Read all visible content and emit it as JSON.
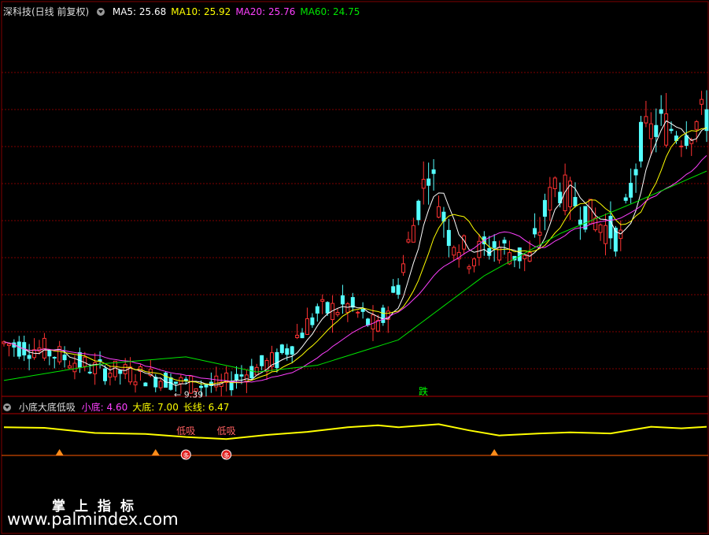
{
  "header": {
    "title": "深科技(日线 前复权)",
    "ma": [
      {
        "label": "MA5: 25.68",
        "color": "#ffffff"
      },
      {
        "label": "MA10: 25.92",
        "color": "#ffff00"
      },
      {
        "label": "MA20: 25.76",
        "color": "#ff40ff"
      },
      {
        "label": "MA60: 24.75",
        "color": "#00e600"
      }
    ]
  },
  "indicator": {
    "title": "小底大底低吸",
    "values": [
      {
        "label": "小底: 4.60",
        "color": "#ff40ff"
      },
      {
        "label": "大底: 7.00",
        "color": "#ffff00"
      },
      {
        "label": "长线: 6.47",
        "color": "#ffff00"
      }
    ],
    "signal_low_buy": [
      "低吸",
      "低吸"
    ],
    "signal_marker": "多"
  },
  "annotations": {
    "low_price": "9.39",
    "drop_marker": "跌"
  },
  "watermark": {
    "line1": "掌上指标",
    "line2": "www.palmindex.com"
  },
  "colors": {
    "up": "#ff3232",
    "down": "#54ffff",
    "grid": "#7f0000",
    "ma5": "#ffffff",
    "ma10": "#ffff00",
    "ma20": "#ff40ff",
    "ma60": "#00e600",
    "indicator_line": "#ffff00",
    "baseline": "#ff5a00"
  },
  "chart_data": {
    "type": "candlestick",
    "price_range": [
      9.0,
      30.0
    ],
    "approx_candles": 140,
    "trend_points": [
      {
        "i": 0,
        "p": 12.0
      },
      {
        "i": 8,
        "p": 11.6
      },
      {
        "i": 18,
        "p": 10.5
      },
      {
        "i": 30,
        "p": 10.0
      },
      {
        "i": 36,
        "p": 9.6
      },
      {
        "i": 43,
        "p": 9.45
      },
      {
        "i": 48,
        "p": 10.3
      },
      {
        "i": 54,
        "p": 11.0
      },
      {
        "i": 62,
        "p": 13.8
      },
      {
        "i": 68,
        "p": 14.2
      },
      {
        "i": 74,
        "p": 12.8
      },
      {
        "i": 78,
        "p": 15.5
      },
      {
        "i": 84,
        "p": 22.5
      },
      {
        "i": 88,
        "p": 18.5
      },
      {
        "i": 92,
        "p": 17.2
      },
      {
        "i": 97,
        "p": 17.8
      },
      {
        "i": 104,
        "p": 17.0
      },
      {
        "i": 109,
        "p": 21.5
      },
      {
        "i": 116,
        "p": 19.5
      },
      {
        "i": 122,
        "p": 18.2
      },
      {
        "i": 126,
        "p": 24.0
      },
      {
        "i": 130,
        "p": 25.0
      },
      {
        "i": 134,
        "p": 24.5
      },
      {
        "i": 139,
        "p": 25.5
      }
    ],
    "ma60_points": [
      {
        "i": 0,
        "p": 9.8
      },
      {
        "i": 20,
        "p": 10.8
      },
      {
        "i": 36,
        "p": 11.2
      },
      {
        "i": 50,
        "p": 10.3
      },
      {
        "i": 62,
        "p": 10.7
      },
      {
        "i": 78,
        "p": 12.2
      },
      {
        "i": 95,
        "p": 16.0
      },
      {
        "i": 110,
        "p": 18.5
      },
      {
        "i": 126,
        "p": 20.5
      },
      {
        "i": 139,
        "p": 22.2
      }
    ],
    "low_signal_index": 33,
    "indicator_line_points": [
      [
        0,
        5.8
      ],
      [
        8,
        5.7
      ],
      [
        18,
        4.7
      ],
      [
        28,
        4.5
      ],
      [
        36,
        3.9
      ],
      [
        44,
        3.5
      ],
      [
        52,
        4.3
      ],
      [
        60,
        4.9
      ],
      [
        68,
        5.8
      ],
      [
        74,
        6.2
      ],
      [
        78,
        5.8
      ],
      [
        86,
        6.4
      ],
      [
        92,
        5.2
      ],
      [
        98,
        4.2
      ],
      [
        106,
        4.6
      ],
      [
        112,
        4.8
      ],
      [
        120,
        4.6
      ],
      [
        128,
        5.9
      ],
      [
        134,
        5.6
      ],
      [
        139,
        5.9
      ]
    ],
    "indicator_range": [
      0,
      10
    ],
    "triangle_indices": [
      11,
      30,
      97
    ],
    "lowbuy_indices": [
      36,
      44
    ]
  }
}
